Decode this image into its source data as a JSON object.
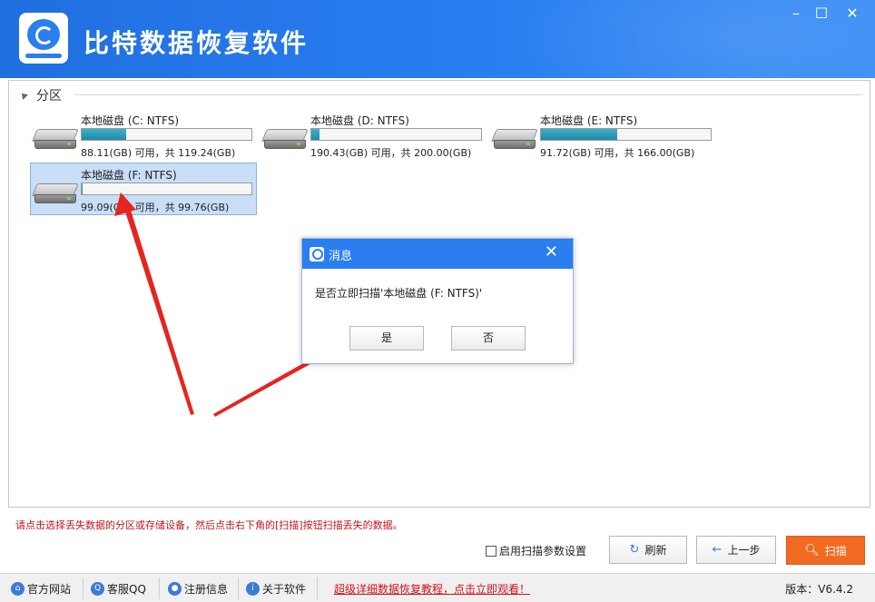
{
  "app": {
    "title": "比特数据恢复软件",
    "window_controls": {
      "minimize": "–",
      "maximize": "☐",
      "close": "✕"
    }
  },
  "partition": {
    "section_label": "分区",
    "drives": [
      {
        "name": "本地磁盘 (C: NTFS)",
        "capacity": "88.11(GB) 可用，共 119.24(GB)",
        "used_fraction": 0.261,
        "selected": false
      },
      {
        "name": "本地磁盘 (D: NTFS)",
        "capacity": "190.43(GB) 可用，共 200.00(GB)",
        "used_fraction": 0.048,
        "selected": false
      },
      {
        "name": "本地磁盘 (E: NTFS)",
        "capacity": "91.72(GB) 可用，共 166.00(GB)",
        "used_fraction": 0.447,
        "selected": false
      },
      {
        "name": "本地磁盘 (F: NTFS)",
        "capacity": "99.09(GB) 可用，共 99.76(GB)",
        "used_fraction": 0.007,
        "selected": true
      }
    ]
  },
  "dialog": {
    "title": "消息",
    "close": "✕",
    "message": "是否立即扫描'本地磁盘 (F: NTFS)'",
    "yes_label": "是",
    "no_label": "否"
  },
  "hint": "请点击选择丢失数据的分区或存储设备，然后点击右下角的[扫描]按钮扫描丢失的数据。",
  "actions": {
    "enable_params_label": "启用扫描参数设置",
    "refresh_label": "刷新",
    "prev_label": "上一步",
    "scan_label": "扫描"
  },
  "footer": {
    "links": [
      {
        "label": "官方网站",
        "icon": "home-icon"
      },
      {
        "label": "客服QQ",
        "icon": "qq-icon"
      },
      {
        "label": "注册信息",
        "icon": "user-icon"
      },
      {
        "label": "关于软件",
        "icon": "info-icon"
      }
    ],
    "promo": "超级详细数据恢复教程，点击立即观看！",
    "version": "版本：V6.4.2"
  },
  "colors": {
    "header_blue": "#2a7ef0",
    "usage_fill": "#1f8aa8",
    "selected_bg": "#c9def7",
    "hint_red": "#c4161c",
    "scan_orange": "#f26a21",
    "arrow_red": "#e5251f"
  }
}
